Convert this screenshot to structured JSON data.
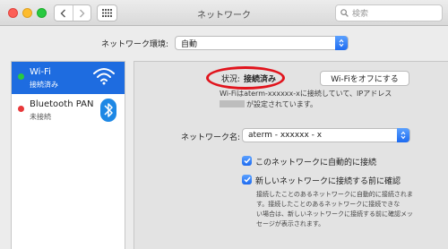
{
  "window": {
    "title": "ネットワーク",
    "search_placeholder": "検索"
  },
  "location": {
    "label": "ネットワーク環境:",
    "value": "自動"
  },
  "sidebar": {
    "items": [
      {
        "name": "Wi-Fi",
        "status": "接続済み",
        "dot_color": "#28c941",
        "selected": true,
        "icon": "wifi-icon"
      },
      {
        "name": "Bluetooth PAN",
        "status": "未接続",
        "dot_color": "#e8383a",
        "selected": false,
        "icon": "bluetooth-icon"
      }
    ]
  },
  "main": {
    "status_label": "状況:",
    "status_value": "接続済み",
    "wifi_off_button": "Wi-Fiをオフにする",
    "status_desc_line1": "Wi-Fiはaterm-xxxxxx-xに接続していて、IPアドレス",
    "status_desc_line2": "が設定されています。",
    "network_name_label": "ネットワーク名:",
    "network_name_value": "aterm - xxxxxx - x",
    "auto_join_label": "このネットワークに自動的に接続",
    "ask_join_label": "新しいネットワークに接続する前に確認",
    "ask_join_desc_line1": "接続したことのあるネットワークに自動的に接続されま",
    "ask_join_desc_line2": "す。接続したことのあるネットワークに接続できな",
    "ask_join_desc_line3": "い場合は、新しいネットワークに接続する前に確認メッ",
    "ask_join_desc_line4": "セージが表示されます。"
  },
  "colors": {
    "accent": "#1e6ce0",
    "highlight_oval": "#e1141d"
  }
}
